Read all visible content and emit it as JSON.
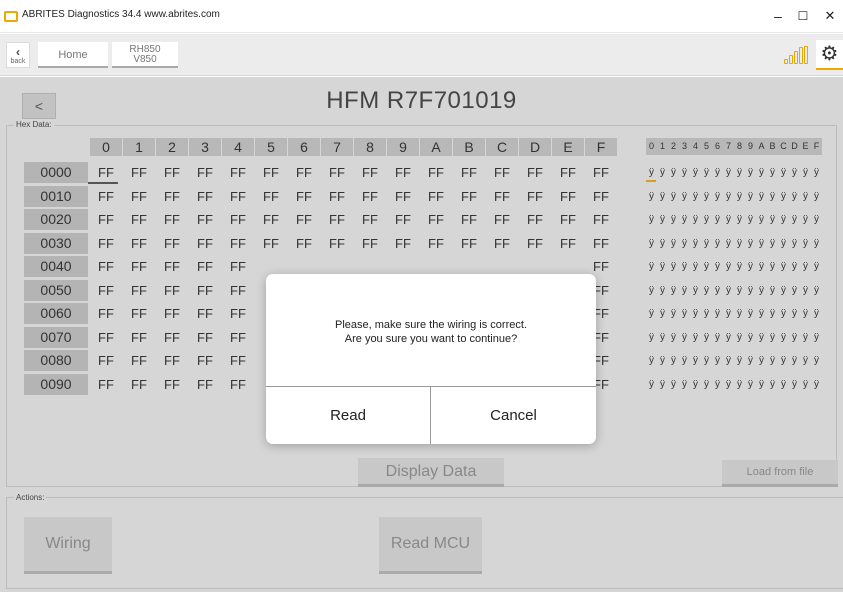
{
  "window": {
    "title": "ABRITES Diagnostics 34.4   www.abrites.com",
    "minimize": "–",
    "maximize": "☐",
    "close": "✕"
  },
  "nav": {
    "back_label": "back",
    "home_label": "Home",
    "chip_line1": "RH850",
    "chip_line2": "V850"
  },
  "header": {
    "back_chevron": "<",
    "title": "HFM R7F701019"
  },
  "hex": {
    "legend": "Hex Data:",
    "columns": [
      "0",
      "1",
      "2",
      "3",
      "4",
      "5",
      "6",
      "7",
      "8",
      "9",
      "A",
      "B",
      "C",
      "D",
      "E",
      "F"
    ],
    "ascii_columns": [
      "0",
      "1",
      "2",
      "3",
      "4",
      "5",
      "6",
      "7",
      "8",
      "9",
      "A",
      "B",
      "C",
      "D",
      "E",
      "F"
    ],
    "rows": [
      {
        "addr": "0000",
        "bytes": [
          "FF",
          "FF",
          "FF",
          "FF",
          "FF",
          "FF",
          "FF",
          "FF",
          "FF",
          "FF",
          "FF",
          "FF",
          "FF",
          "FF",
          "FF",
          "FF"
        ],
        "ascii": [
          "ÿ",
          "ÿ",
          "ÿ",
          "ÿ",
          "ÿ",
          "ÿ",
          "ÿ",
          "ÿ",
          "ÿ",
          "ÿ",
          "ÿ",
          "ÿ",
          "ÿ",
          "ÿ",
          "ÿ",
          "ÿ"
        ]
      },
      {
        "addr": "0010",
        "bytes": [
          "FF",
          "FF",
          "FF",
          "FF",
          "FF",
          "FF",
          "FF",
          "FF",
          "FF",
          "FF",
          "FF",
          "FF",
          "FF",
          "FF",
          "FF",
          "FF"
        ],
        "ascii": [
          "ÿ",
          "ÿ",
          "ÿ",
          "ÿ",
          "ÿ",
          "ÿ",
          "ÿ",
          "ÿ",
          "ÿ",
          "ÿ",
          "ÿ",
          "ÿ",
          "ÿ",
          "ÿ",
          "ÿ",
          "ÿ"
        ]
      },
      {
        "addr": "0020",
        "bytes": [
          "FF",
          "FF",
          "FF",
          "FF",
          "FF",
          "FF",
          "FF",
          "FF",
          "FF",
          "FF",
          "FF",
          "FF",
          "FF",
          "FF",
          "FF",
          "FF"
        ],
        "ascii": [
          "ÿ",
          "ÿ",
          "ÿ",
          "ÿ",
          "ÿ",
          "ÿ",
          "ÿ",
          "ÿ",
          "ÿ",
          "ÿ",
          "ÿ",
          "ÿ",
          "ÿ",
          "ÿ",
          "ÿ",
          "ÿ"
        ]
      },
      {
        "addr": "0030",
        "bytes": [
          "FF",
          "FF",
          "FF",
          "FF",
          "FF",
          "FF",
          "FF",
          "FF",
          "FF",
          "FF",
          "FF",
          "FF",
          "FF",
          "FF",
          "FF",
          "FF"
        ],
        "ascii": [
          "ÿ",
          "ÿ",
          "ÿ",
          "ÿ",
          "ÿ",
          "ÿ",
          "ÿ",
          "ÿ",
          "ÿ",
          "ÿ",
          "ÿ",
          "ÿ",
          "ÿ",
          "ÿ",
          "ÿ",
          "ÿ"
        ]
      },
      {
        "addr": "0040",
        "bytes": [
          "FF",
          "FF",
          "FF",
          "FF",
          "FF",
          "",
          "",
          "",
          "",
          "",
          "",
          "",
          "",
          "",
          "",
          "FF"
        ],
        "ascii": [
          "ÿ",
          "ÿ",
          "ÿ",
          "ÿ",
          "ÿ",
          "ÿ",
          "ÿ",
          "ÿ",
          "ÿ",
          "ÿ",
          "ÿ",
          "ÿ",
          "ÿ",
          "ÿ",
          "ÿ",
          "ÿ"
        ]
      },
      {
        "addr": "0050",
        "bytes": [
          "FF",
          "FF",
          "FF",
          "FF",
          "FF",
          "",
          "",
          "",
          "",
          "",
          "",
          "",
          "",
          "",
          "",
          "FF"
        ],
        "ascii": [
          "ÿ",
          "ÿ",
          "ÿ",
          "ÿ",
          "ÿ",
          "ÿ",
          "ÿ",
          "ÿ",
          "ÿ",
          "ÿ",
          "ÿ",
          "ÿ",
          "ÿ",
          "ÿ",
          "ÿ",
          "ÿ"
        ]
      },
      {
        "addr": "0060",
        "bytes": [
          "FF",
          "FF",
          "FF",
          "FF",
          "FF",
          "",
          "",
          "",
          "",
          "",
          "",
          "",
          "",
          "",
          "",
          "FF"
        ],
        "ascii": [
          "ÿ",
          "ÿ",
          "ÿ",
          "ÿ",
          "ÿ",
          "ÿ",
          "ÿ",
          "ÿ",
          "ÿ",
          "ÿ",
          "ÿ",
          "ÿ",
          "ÿ",
          "ÿ",
          "ÿ",
          "ÿ"
        ]
      },
      {
        "addr": "0070",
        "bytes": [
          "FF",
          "FF",
          "FF",
          "FF",
          "FF",
          "",
          "",
          "",
          "",
          "",
          "",
          "",
          "",
          "",
          "",
          "FF"
        ],
        "ascii": [
          "ÿ",
          "ÿ",
          "ÿ",
          "ÿ",
          "ÿ",
          "ÿ",
          "ÿ",
          "ÿ",
          "ÿ",
          "ÿ",
          "ÿ",
          "ÿ",
          "ÿ",
          "ÿ",
          "ÿ",
          "ÿ"
        ]
      },
      {
        "addr": "0080",
        "bytes": [
          "FF",
          "FF",
          "FF",
          "FF",
          "FF",
          "",
          "",
          "",
          "",
          "",
          "",
          "",
          "",
          "",
          "",
          "FF"
        ],
        "ascii": [
          "ÿ",
          "ÿ",
          "ÿ",
          "ÿ",
          "ÿ",
          "ÿ",
          "ÿ",
          "ÿ",
          "ÿ",
          "ÿ",
          "ÿ",
          "ÿ",
          "ÿ",
          "ÿ",
          "ÿ",
          "ÿ"
        ]
      },
      {
        "addr": "0090",
        "bytes": [
          "FF",
          "FF",
          "FF",
          "FF",
          "FF",
          "",
          "",
          "",
          "",
          "",
          "",
          "",
          "",
          "",
          "",
          "FF"
        ],
        "ascii": [
          "ÿ",
          "ÿ",
          "ÿ",
          "ÿ",
          "ÿ",
          "ÿ",
          "ÿ",
          "ÿ",
          "ÿ",
          "ÿ",
          "ÿ",
          "ÿ",
          "ÿ",
          "ÿ",
          "ÿ",
          "ÿ"
        ]
      }
    ]
  },
  "buttons": {
    "display_data": "Display Data",
    "load_from_file": "Load from file"
  },
  "actions": {
    "legend": "Actions:",
    "wiring": "Wiring",
    "read_mcu": "Read MCU"
  },
  "dialog": {
    "message_line1": "Please, make sure the wiring is correct.",
    "message_line2": "Are you sure you want to continue?",
    "read_label": "Read",
    "cancel_label": "Cancel"
  },
  "colors": {
    "accent": "#f0a800",
    "background": "#d6d6d6",
    "header_cell": "#b4b4b4"
  },
  "icons": {
    "app": "abrites-logo-icon",
    "signal": "signal-strength-icon",
    "settings": "gear-icon"
  }
}
